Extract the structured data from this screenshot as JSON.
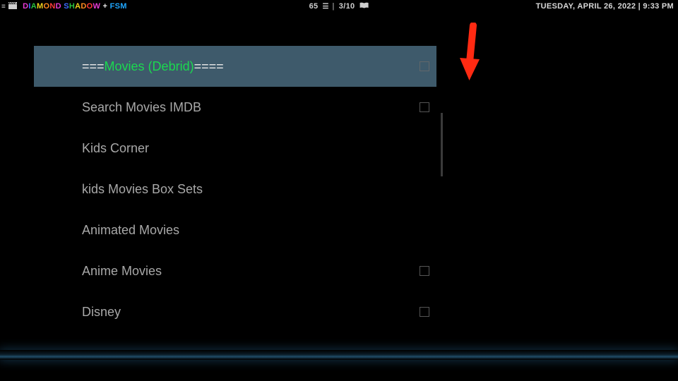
{
  "header": {
    "title_parts": [
      {
        "text": "D",
        "color": "#e63bd4"
      },
      {
        "text": "I",
        "color": "#3b6bff"
      },
      {
        "text": "A",
        "color": "#28c23c"
      },
      {
        "text": "M",
        "color": "#f2d21b"
      },
      {
        "text": "O",
        "color": "#ff8a1e"
      },
      {
        "text": "N",
        "color": "#ff3b3b"
      },
      {
        "text": "D",
        "color": "#e63bd4"
      },
      {
        "text": " ",
        "color": "#ffffff"
      },
      {
        "text": "S",
        "color": "#3b6bff"
      },
      {
        "text": "H",
        "color": "#28c23c"
      },
      {
        "text": "A",
        "color": "#f2d21b"
      },
      {
        "text": "D",
        "color": "#ff8a1e"
      },
      {
        "text": "O",
        "color": "#ff3b3b"
      },
      {
        "text": "W",
        "color": "#e63bd4"
      },
      {
        "text": " + ",
        "color": "#e8e8e8"
      },
      {
        "text": "FSM",
        "color": "#1fa7ff"
      }
    ],
    "count": "65",
    "page_position": "3/10",
    "datetime": "TUESDAY, APRIL 26, 2022 | 9:33 PM"
  },
  "list": {
    "selected_index": 0,
    "items": [
      {
        "label": "===Movies (Debrid)====",
        "sel_prefix": "===",
        "sel_mid": "Movies (Debrid)",
        "sel_suffix": "====",
        "has_checkbox": true
      },
      {
        "label": "Search Movies IMDB",
        "has_checkbox": true
      },
      {
        "label": "Kids Corner",
        "has_checkbox": false
      },
      {
        "label": "kids Movies Box Sets",
        "has_checkbox": false
      },
      {
        "label": "Animated Movies",
        "has_checkbox": false
      },
      {
        "label": "Anime  Movies",
        "has_checkbox": true
      },
      {
        "label": "Disney",
        "has_checkbox": true
      }
    ]
  },
  "annotation": {
    "arrow_color": "#ff2a12"
  }
}
